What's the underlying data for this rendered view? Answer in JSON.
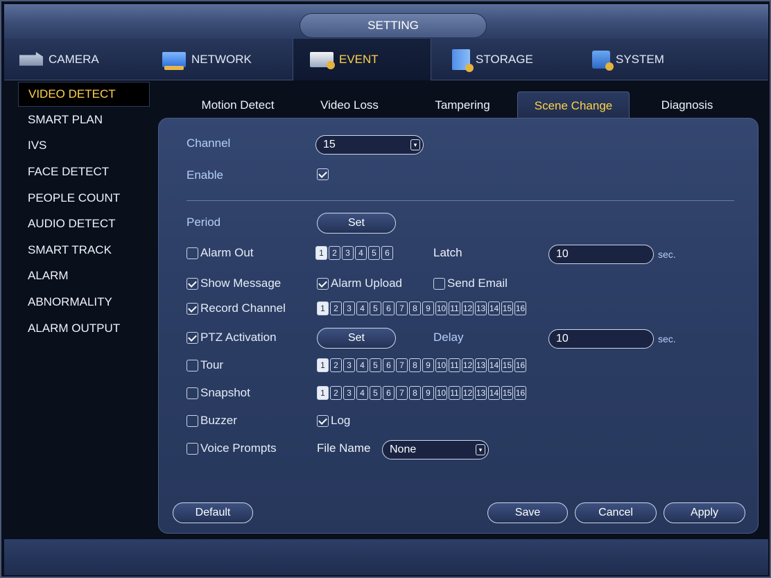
{
  "title": "SETTING",
  "top_tabs": [
    {
      "label": "CAMERA",
      "icon": "camera-icon"
    },
    {
      "label": "NETWORK",
      "icon": "network-icon"
    },
    {
      "label": "EVENT",
      "icon": "event-icon",
      "active": true
    },
    {
      "label": "STORAGE",
      "icon": "storage-icon"
    },
    {
      "label": "SYSTEM",
      "icon": "system-icon"
    }
  ],
  "sidebar": [
    {
      "label": "VIDEO DETECT",
      "active": true
    },
    {
      "label": "SMART PLAN"
    },
    {
      "label": "IVS"
    },
    {
      "label": "FACE DETECT"
    },
    {
      "label": "PEOPLE COUNT"
    },
    {
      "label": "AUDIO DETECT"
    },
    {
      "label": "SMART TRACK"
    },
    {
      "label": "ALARM"
    },
    {
      "label": "ABNORMALITY"
    },
    {
      "label": "ALARM OUTPUT"
    }
  ],
  "sub_tabs": [
    {
      "label": "Motion Detect"
    },
    {
      "label": "Video Loss"
    },
    {
      "label": "Tampering"
    },
    {
      "label": "Scene Change",
      "active": true
    },
    {
      "label": "Diagnosis"
    }
  ],
  "form": {
    "channel_label": "Channel",
    "channel_value": "15",
    "enable_label": "Enable",
    "enable_checked": true,
    "period_label": "Period",
    "period_button": "Set",
    "alarm_out_label": "Alarm Out",
    "alarm_out_checked": false,
    "alarm_out_numbers": [
      "1",
      "2",
      "3",
      "4",
      "5",
      "6"
    ],
    "latch_label": "Latch",
    "latch_value": "10",
    "sec_label": "sec.",
    "show_message_label": "Show Message",
    "show_message_checked": true,
    "alarm_upload_label": "Alarm Upload",
    "alarm_upload_checked": true,
    "send_email_label": "Send Email",
    "send_email_checked": false,
    "record_channel_label": "Record Channel",
    "record_channel_checked": true,
    "ptz_activation_label": "PTZ Activation",
    "ptz_activation_checked": true,
    "ptz_button": "Set",
    "delay_label": "Delay",
    "delay_value": "10",
    "tour_label": "Tour",
    "tour_checked": false,
    "snapshot_label": "Snapshot",
    "snapshot_checked": false,
    "buzzer_label": "Buzzer",
    "buzzer_checked": false,
    "log_label": "Log",
    "log_checked": true,
    "voice_prompts_label": "Voice Prompts",
    "voice_prompts_checked": false,
    "file_name_label": "File Name",
    "file_name_value": "None",
    "channel_numbers": [
      "1",
      "2",
      "3",
      "4",
      "5",
      "6",
      "7",
      "8",
      "9",
      "10",
      "11",
      "12",
      "13",
      "14",
      "15",
      "16"
    ]
  },
  "buttons": {
    "default": "Default",
    "save": "Save",
    "cancel": "Cancel",
    "apply": "Apply"
  },
  "colors": {
    "accent": "#ffd34a",
    "label": "#b6cff8",
    "panel": "#2c3e65"
  }
}
